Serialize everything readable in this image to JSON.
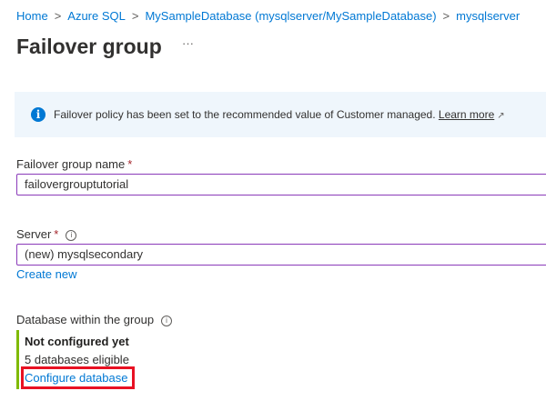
{
  "breadcrumb": [
    "Home",
    "Azure SQL",
    "MySampleDatabase (mysqlserver/MySampleDatabase)",
    "mysqlserver"
  ],
  "page": {
    "title": "Failover group",
    "more": "···"
  },
  "info": {
    "text": "Failover policy has been set to the recommended value of Customer managed.",
    "link": "Learn more",
    "icon": "info-icon"
  },
  "form": {
    "name_label": "Failover group name",
    "required": "*",
    "name_value": "failovergrouptutorial",
    "server_label": "Server",
    "server_value": "(new) mysqlsecondary",
    "create_new": "Create new",
    "db_label": "Database within the group",
    "db_status": "Not configured yet",
    "db_eligible": "5 databases eligible",
    "configure": "Configure database"
  },
  "colors": {
    "accent": "#0078d4",
    "input_border": "#8a3ab9",
    "status_bar": "#7fba00",
    "highlight": "#e81123"
  }
}
